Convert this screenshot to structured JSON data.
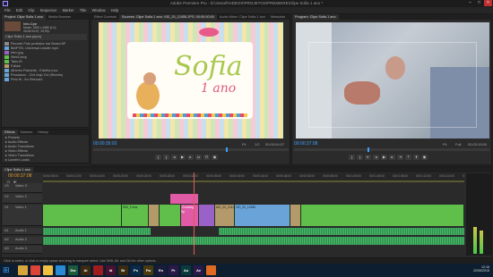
{
  "window": {
    "title": "Adobe Premiere Pro - D:\\Jessel\\VIDEOS\\PROJETOS\\PREMIERE\\Clipe Sofia 1 ano *",
    "controls": [
      "–",
      "□",
      "✕"
    ]
  },
  "menu": [
    "File",
    "Edit",
    "Clip",
    "Sequence",
    "Marker",
    "Title",
    "Window",
    "Help"
  ],
  "project_panel": {
    "tabs": [
      "Project: Clipe Sofia 1 ano",
      "Media Browser"
    ],
    "clip_name": "Info.Cpe",
    "clip_meta": "Movie, 1920 x 1080 (1.0)",
    "clip_time": "00:00:04:07, 29,97p",
    "project_label": "Clipe Sofia 1 ano.prproj",
    "bins": [
      {
        "label": "Recorte Pots proibidor bar Board 8P",
        "color": "#8a8a8a"
      },
      {
        "label": "BMPTEL Universal Leader.mp4",
        "color": "#6aa3d8"
      },
      {
        "label": "Intro.jpg",
        "color": "#9a62c8"
      },
      {
        "label": "WebCamp",
        "color": "#5fbf4a"
      },
      {
        "label": "Tabs.ID",
        "color": "#5fbf4a"
      },
      {
        "label": "Foliasi",
        "color": "#b49a6a"
      },
      {
        "label": "Alheres Palrainte - Edetha.mov",
        "color": "#6aa3d8"
      },
      {
        "label": "Prooianon - Cint Asjo Cel (Sburbs)",
        "color": "#6aa3d8"
      },
      {
        "label": "Peto fb - fro Seluvar1",
        "color": "#6aa3d8"
      }
    ]
  },
  "effects_panel": {
    "tabs": [
      "Effects",
      "Markers",
      "History"
    ],
    "items": [
      "Presets",
      "Audio Effects",
      "Audio Transitions",
      "Video Effects",
      "Video Transitions",
      "Lumetri Looks"
    ]
  },
  "source_monitor": {
    "tabs": [
      "Effect Controls",
      "Sources: Clipe Sofia 1 ano: VID_20_12455.JPG: 00:00:00:00",
      "Audio Mixer: Clipe Sofia 1 ano",
      "Metadata"
    ],
    "card_title": "Sofia",
    "card_subtitle": "1 ano",
    "timecode": "00:00:39:02",
    "fit": "Fit",
    "fraction": "1/2",
    "duration": "00:00:04:07"
  },
  "program_monitor": {
    "tabs": [
      "Program: Clipe Sofia 1 ano"
    ],
    "timecode": "00:00:37:08",
    "fit": "Fit",
    "fraction": "Full",
    "duration": "00:03:15:00"
  },
  "timeline": {
    "tabs": [
      "Clipe Sofia 1 ano"
    ],
    "timecode": "00:00:37:08",
    "ruler": [
      "00:00:08:00",
      "00:00:12:00",
      "00:00:16:00",
      "00:00:20:00",
      "00:00:24:00",
      "00:00:28:00",
      "00:00:32:00",
      "00:00:36:00",
      "00:00:40:00",
      "00:00:44:00",
      "00:00:48:00",
      "00:00:52:00",
      "00:00:56:00",
      "00:01:00:00",
      "00:01:04:00",
      "00:01:08:00",
      "00:01:12:00",
      "00:01:16:00",
      "00:01:20:00"
    ],
    "tracks": [
      {
        "name": "V3",
        "label": "Video 3"
      },
      {
        "name": "V2",
        "label": "Video 2"
      },
      {
        "name": "V1",
        "label": "Video 1"
      },
      {
        "name": "A1",
        "label": "Audio 1"
      },
      {
        "name": "A2",
        "label": "Audio 2"
      },
      {
        "name": "A3",
        "label": "Audio 3"
      }
    ],
    "clip_labels": {
      "v1_a": "IMG_Fotos",
      "v1_b": "Crossing Sp",
      "v2_a": "AID_20_1241",
      "v1_c": "VID_20_12456"
    }
  },
  "status": {
    "text": "Click to select, or click in empty space and drag to marquee select. Use Shift, Alt, and Ctrl for other options."
  },
  "taskbar": {
    "icons": [
      {
        "name": "file-explorer-icon",
        "glyph": "",
        "color": "#d7a53c"
      },
      {
        "name": "chrome-icon",
        "glyph": "",
        "color": "#db4437"
      },
      {
        "name": "folder-icon",
        "glyph": "",
        "color": "#f0c040"
      },
      {
        "name": "media-icon",
        "glyph": "",
        "color": "#2a8ad4"
      },
      {
        "name": "dreamweaver-icon",
        "glyph": "Dw",
        "color": "#1c5a3c"
      },
      {
        "name": "illustrator-icon",
        "glyph": "Ai",
        "color": "#3c2a10"
      },
      {
        "name": "acrobat-icon",
        "glyph": "",
        "color": "#a01c1c"
      },
      {
        "name": "indesign-icon",
        "glyph": "Id",
        "color": "#4a1030"
      },
      {
        "name": "bridge-icon",
        "glyph": "Br",
        "color": "#3a2a10"
      },
      {
        "name": "photoshop-icon",
        "glyph": "Ps",
        "color": "#0a2a4a"
      },
      {
        "name": "fireworks-icon",
        "glyph": "Fw",
        "color": "#4a3a10"
      },
      {
        "name": "encore-icon",
        "glyph": "En",
        "color": "#1a1a3a"
      },
      {
        "name": "premiere-icon",
        "glyph": "Pr",
        "color": "#2a1a4a"
      },
      {
        "name": "audition-icon",
        "glyph": "Au",
        "color": "#0a3a3a"
      },
      {
        "name": "after-effects-icon",
        "glyph": "Ae",
        "color": "#2a1a4a"
      },
      {
        "name": "firefox-icon",
        "glyph": "",
        "color": "#e06a20"
      }
    ],
    "clock_time": "12:16",
    "clock_date": "22/05/2015"
  }
}
